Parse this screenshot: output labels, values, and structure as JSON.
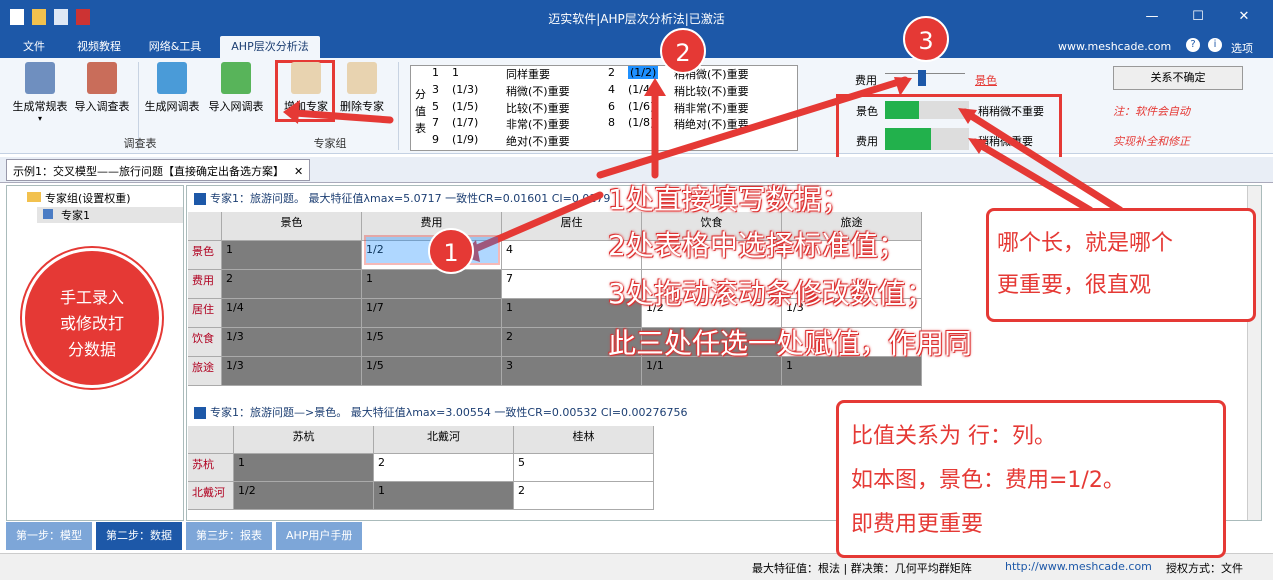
{
  "window": {
    "title": "迈实软件|AHP层次分析法|已激活",
    "website": "www.meshcade.com",
    "options": "选项"
  },
  "menu": [
    "文件",
    "视频教程",
    "网络&工具",
    "AHP层次分析法"
  ],
  "ribbon": {
    "buttons": [
      "生成常规表",
      "导入调查表",
      "生成网调表",
      "导入网调表",
      "增加专家",
      "删除专家"
    ],
    "groups": [
      "调查表",
      "专家组"
    ]
  },
  "value_table": {
    "side_label": [
      "分",
      "值",
      "表"
    ],
    "rows": [
      [
        "1",
        "1",
        "同样重要",
        "2",
        "(1/2)",
        "稍稍微(不)重要"
      ],
      [
        "3",
        "(1/3)",
        "稍微(不)重要",
        "4",
        "(1/4)",
        "稍比较(不)重要"
      ],
      [
        "5",
        "(1/5)",
        "比较(不)重要",
        "6",
        "(1/6)",
        "稍非常(不)重要"
      ],
      [
        "7",
        "(1/7)",
        "非常(不)重要",
        "8",
        "(1/8)",
        "稍绝对(不)重要"
      ],
      [
        "9",
        "(1/9)",
        "绝对(不)重要",
        "",
        "",
        ""
      ]
    ]
  },
  "slider": {
    "left": "费用",
    "right": "景色"
  },
  "bars": [
    {
      "label": "景色",
      "text": "稍稍微不重要"
    },
    {
      "label": "费用",
      "text": "稍稍微重要"
    }
  ],
  "relation_button": "关系不确定",
  "note": [
    "注：软件会自动",
    "实现补全和修正"
  ],
  "doc_tab": "示例1：交叉模型——旅行问题【直接确定出备选方案】",
  "tree": {
    "root": "专家组(设置权重)",
    "child": "专家1"
  },
  "matrix1": {
    "caption": "专家1：旅游问题。 最大特征值λmax=5.0717 一致性CR=0.01601 CI=0.0179",
    "cols": [
      "景色",
      "费用",
      "居住",
      "饮食",
      "旅途"
    ],
    "rows": [
      {
        "h": "景色",
        "v": [
          "1",
          "1/2",
          "4",
          "",
          ""
        ]
      },
      {
        "h": "费用",
        "v": [
          "2",
          "1",
          "7",
          "",
          ""
        ]
      },
      {
        "h": "居住",
        "v": [
          "1/4",
          "1/7",
          "1",
          "1/2",
          "1/3"
        ]
      },
      {
        "h": "饮食",
        "v": [
          "1/3",
          "1/5",
          "2",
          "",
          ""
        ]
      },
      {
        "h": "旅途",
        "v": [
          "1/3",
          "1/5",
          "3",
          "1/1",
          "1"
        ]
      }
    ]
  },
  "matrix2": {
    "caption": "专家1：旅游问题—>景色。 最大特征值λmax=3.00554 一致性CR=0.00532 CI=0.00276756",
    "cols": [
      "苏杭",
      "北戴河",
      "桂林"
    ],
    "rows": [
      {
        "h": "苏杭",
        "v": [
          "1",
          "2",
          "5"
        ]
      },
      {
        "h": "北戴河",
        "v": [
          "1/2",
          "1",
          "2"
        ]
      }
    ]
  },
  "steps": [
    "第一步：模型",
    "第二步：数据",
    "第三步：报表",
    "AHP用户手册"
  ],
  "status": {
    "left": "最大特征值：根法 | 群决策：几何平均群矩阵",
    "url": "http://www.meshcade.com",
    "right": "授权方式：文件"
  },
  "annotations": {
    "left_callout": [
      "手工录入",
      "或修改打",
      "分数据"
    ],
    "center_lines": [
      "1处直接填写数据；",
      "2处表格中选择标准值；",
      "3处拖动滚动条修改数值；",
      "此三处任选一处赋值，作用同"
    ],
    "right_top": [
      "哪个长，就是哪个",
      "更重要，很直观"
    ],
    "right_bottom": [
      "比值关系为 行：列。",
      "如本图，景色：费用=1/2。",
      "即费用更重要"
    ],
    "numbers": [
      "1",
      "2",
      "3"
    ]
  },
  "colors": {
    "title": "#1d58a8",
    "accent": "#e53935",
    "gray_cell": "#7d7d7d",
    "bar": "#22b14c"
  }
}
